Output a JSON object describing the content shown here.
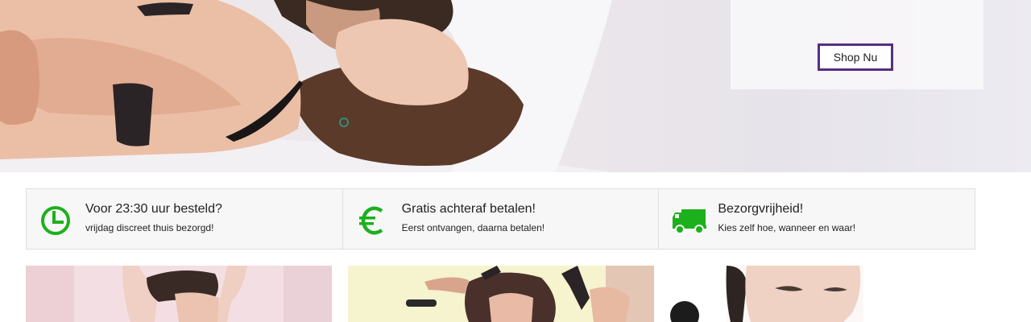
{
  "hero": {
    "promo_title": "",
    "shop_button": "Shop Nu"
  },
  "usps": [
    {
      "icon": "clock-icon",
      "title": "Voor 23:30 uur besteld?",
      "subtitle": "vrijdag discreet thuis bezorgd!"
    },
    {
      "icon": "euro-icon",
      "title": "Gratis achteraf betalen!",
      "subtitle": "Eerst ontvangen, daarna betalen!"
    },
    {
      "icon": "delivery-truck-icon",
      "title": "Bezorgvrijheid!",
      "subtitle": "Kies zelf hoe, wanneer en waar!"
    }
  ],
  "colors": {
    "accent_purple": "#5a2d80",
    "icon_green": "#1db01d",
    "usp_background": "#f7f7f7",
    "border": "#dedede"
  },
  "tiles": [
    {
      "image": "lingerie-model-photo"
    },
    {
      "image": "fashion-model-with-heels-photo"
    },
    {
      "image": "woman-with-product-photo"
    }
  ]
}
